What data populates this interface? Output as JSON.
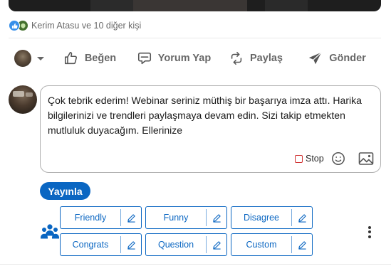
{
  "reactions": {
    "summary": "Kerim Atasu ve 10 diğer kişi",
    "icons": [
      "like-reaction-icon",
      "support-reaction-icon"
    ]
  },
  "actions": {
    "like": "Beğen",
    "comment": "Yorum Yap",
    "share": "Paylaş",
    "send": "Gönder"
  },
  "comment": {
    "text": "Çok tebrik ederim! Webinar seriniz müthiş bir başarıya imza attı. Harika bilgilerinizi ve trendleri paylaşmaya devam edin. Sizi takip etmekten mutluluk duyacağım. Ellerinize",
    "stop_label": "Stop"
  },
  "post_button": "Yayınla",
  "tones": [
    {
      "label": "Friendly"
    },
    {
      "label": "Funny"
    },
    {
      "label": "Disagree"
    },
    {
      "label": "Congrats"
    },
    {
      "label": "Question"
    },
    {
      "label": "Custom"
    }
  ],
  "colors": {
    "accent": "#0a66c2",
    "text_muted": "#666666",
    "stop_box": "#d03030"
  }
}
